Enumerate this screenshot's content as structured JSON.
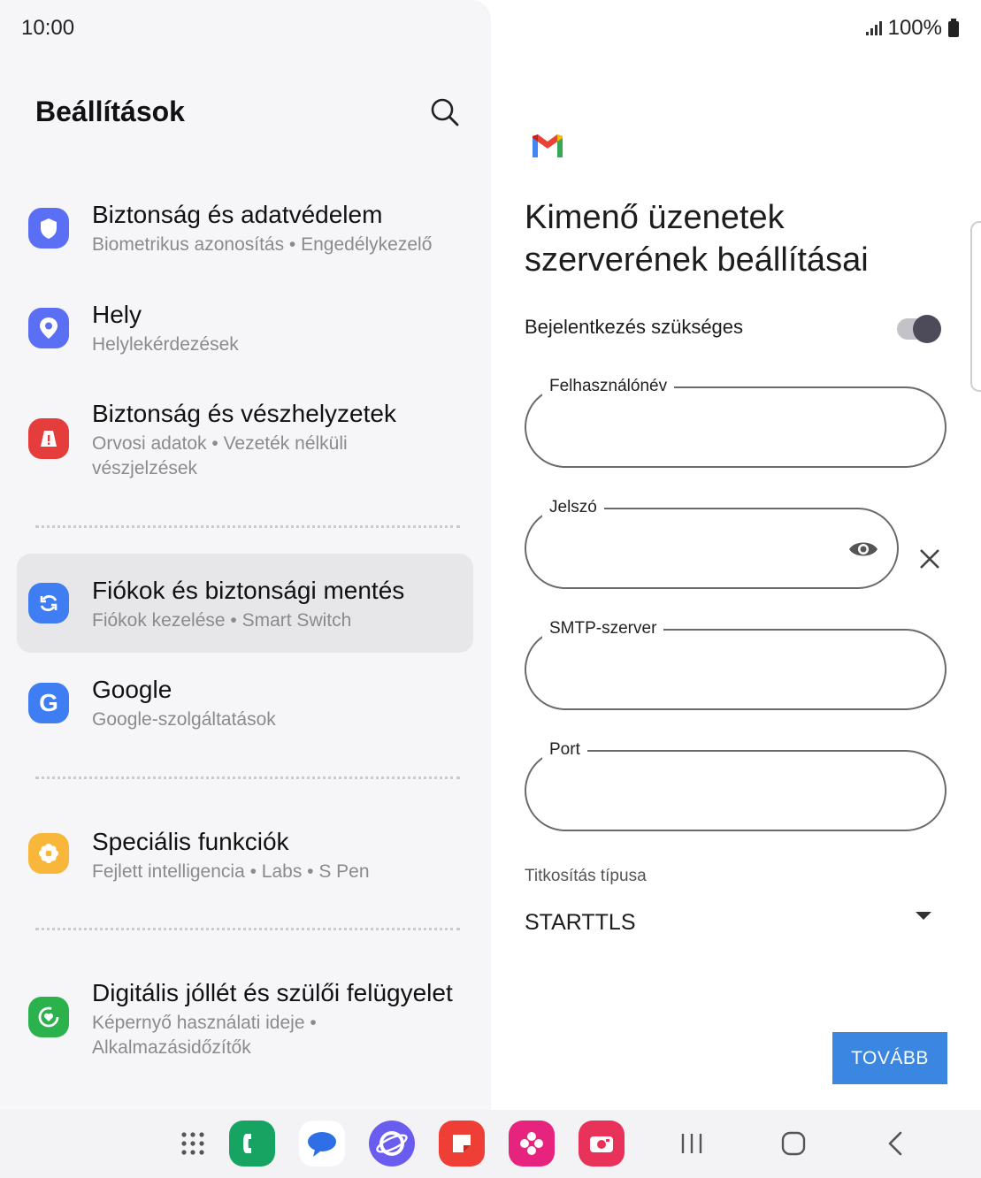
{
  "status_bar": {
    "time": "10:00",
    "battery": "100%"
  },
  "settings": {
    "title": "Beállítások",
    "items": [
      {
        "title": "Biztonság és adatvédelem",
        "subtitle": "Biometrikus azonosítás  •  Engedélykezelő",
        "icon": "shield-icon",
        "color": "#5b6ff5"
      },
      {
        "title": "Hely",
        "subtitle": "Helylekérdezések",
        "icon": "location-pin-icon",
        "color": "#5b6ff5"
      },
      {
        "title": "Biztonság és vészhelyzetek",
        "subtitle": "Orvosi adatok  •  Vezeték nélküli vészjelzések",
        "icon": "emergency-icon",
        "color": "#e53c3c"
      },
      {
        "title": "Fiókok és biztonsági mentés",
        "subtitle": "Fiókok kezelése  •  Smart Switch",
        "icon": "sync-icon",
        "color": "#3f7df2",
        "selected": true
      },
      {
        "title": "Google",
        "subtitle": "Google-szolgáltatások",
        "icon": "google-icon",
        "color": "#3f7df2"
      },
      {
        "title": "Speciális funkciók",
        "subtitle": "Fejlett intelligencia  •  Labs  •  S Pen",
        "icon": "gear-flower-icon",
        "color": "#f8b73a"
      },
      {
        "title": "Digitális jóllét és szülői felügyelet",
        "subtitle": "Képernyő használati ideje  •  Alkalmazásidőzítők",
        "icon": "wellbeing-icon",
        "color": "#2bb24c"
      }
    ]
  },
  "outgoing": {
    "title": "Kimenő üzenetek szerverének beállításai",
    "toggle_label": "Bejelentkezés szükséges",
    "toggle_on": true,
    "fields": {
      "username": {
        "label": "Felhasználónév",
        "value": ""
      },
      "password": {
        "label": "Jelszó",
        "value": ""
      },
      "smtp": {
        "label": "SMTP-szerver",
        "value": ""
      },
      "port": {
        "label": "Port",
        "value": ""
      }
    },
    "encryption_label": "Titkosítás típusa",
    "encryption_value": "STARTTLS",
    "next_button": "TOVÁBB",
    "accent_color": "#3a86e0"
  },
  "taskbar": {
    "apps": [
      "apps-grid-icon",
      "phone-icon",
      "messages-icon",
      "internet-icon",
      "notes-icon",
      "gallery-icon",
      "camera-icon"
    ],
    "nav": [
      "recents-icon",
      "home-icon",
      "back-icon"
    ]
  }
}
